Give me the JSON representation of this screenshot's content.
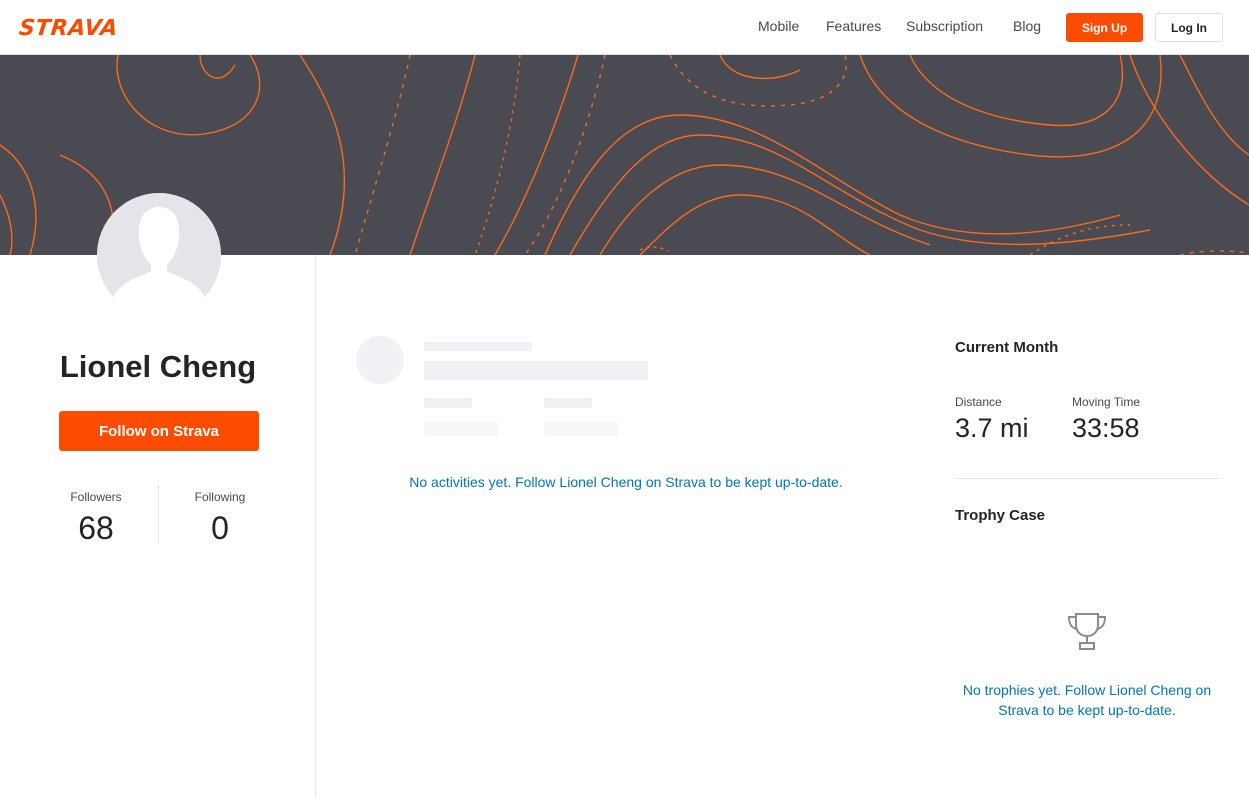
{
  "header": {
    "logo": "STRAVA",
    "nav": [
      "Mobile",
      "Features",
      "Subscription",
      "Blog"
    ],
    "signup_label": "Sign Up",
    "login_label": "Log In"
  },
  "profile": {
    "name": "Lionel Cheng",
    "follow_label": "Follow on Strava",
    "followers_label": "Followers",
    "followers_count": "68",
    "following_label": "Following",
    "following_count": "0"
  },
  "activities": {
    "empty_message": "No activities yet. Follow Lionel Cheng on Strava to be kept up-to-date."
  },
  "current_month": {
    "title": "Current Month",
    "distance_label": "Distance",
    "distance_value": "3.7 mi",
    "time_label": "Moving Time",
    "time_value": "33:58"
  },
  "trophy_case": {
    "title": "Trophy Case",
    "empty_message": "No trophies yet. Follow Lionel Cheng on Strava to be kept up-to-date."
  },
  "colors": {
    "brand": "#fc4c02",
    "link": "#0077b6",
    "cover_bg": "#4a4a52"
  },
  "icons": [
    "trophy-icon",
    "avatar-silhouette"
  ]
}
